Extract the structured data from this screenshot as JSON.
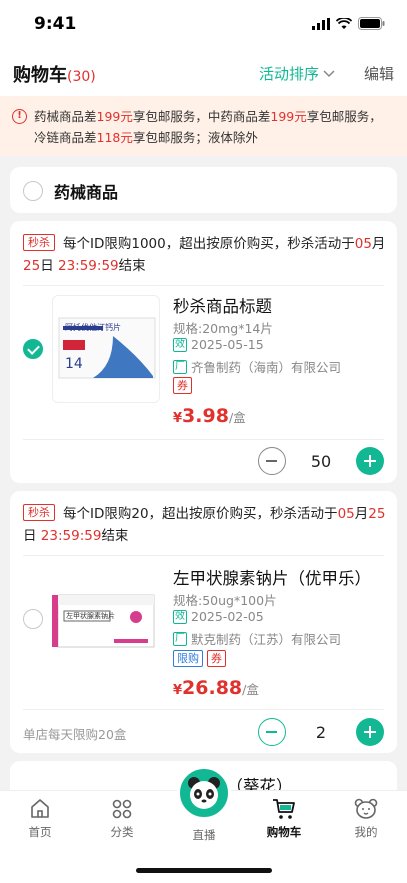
{
  "status_bar": {
    "time": "9:41"
  },
  "header": {
    "title": "购物车",
    "count": "(30)",
    "sort_label": "活动排序",
    "edit_label": "编辑"
  },
  "notice": {
    "line1_a": "药械商品差",
    "line1_b": "199元",
    "line1_c": "享包邮服务，中药商品差",
    "line1_d": "199元",
    "line1_e": "享包邮服务，",
    "line2_a": "冷链商品差",
    "line2_b": "118元",
    "line2_c": "享包邮服务；液体除外"
  },
  "group": {
    "title": "药械商品"
  },
  "items": [
    {
      "promo_tag": "秒杀",
      "promo_a": "每个ID限购1000，超出按原价购买，秒杀活动于",
      "promo_month": "05",
      "promo_b": "月",
      "promo_day": "25",
      "promo_c": "日",
      "promo_time": "23:59:59",
      "promo_d": "结束",
      "name": "秒杀商品标题",
      "spec": "规格:20mg*14片",
      "expiry_tag": "效",
      "expiry": "2025-05-15",
      "maker_tag": "厂",
      "maker": "齐鲁制药（海南）有限公司",
      "tags": [
        "券"
      ],
      "price_symbol": "¥",
      "price": "3.98",
      "unit": "/盒",
      "qty": "50",
      "checked": true,
      "img_text": "阿托伐他汀钙片"
    },
    {
      "promo_tag": "秒杀",
      "promo_a": "每个ID限购20，超出按原价购买，秒杀活动于",
      "promo_month": "05",
      "promo_b": "月",
      "promo_day": "25",
      "promo_c": "日",
      "promo_time": "23:59:59",
      "promo_d": "结束",
      "name": "左甲状腺素钠片（优甲乐）",
      "spec": "规格:50ug*100片",
      "expiry_tag": "效",
      "expiry": "2025-02-05",
      "maker_tag": "厂",
      "maker": "默克制药（江苏）有限公司",
      "tags": [
        "限购",
        "券"
      ],
      "price_symbol": "¥",
      "price": "26.88",
      "unit": "/盒",
      "qty": "2",
      "limit_note": "单店每天限购20盒",
      "checked": false,
      "img_text": "左甲状腺素钠片"
    },
    {
      "name_partial": "栓（葵花）"
    }
  ],
  "tabbar": {
    "home": "首页",
    "category": "分类",
    "live": "直播",
    "cart": "购物车",
    "mine": "我的"
  },
  "colors": {
    "accent": "#12b894",
    "price": "#e0312d",
    "notice_bg": "#fff1e8"
  }
}
